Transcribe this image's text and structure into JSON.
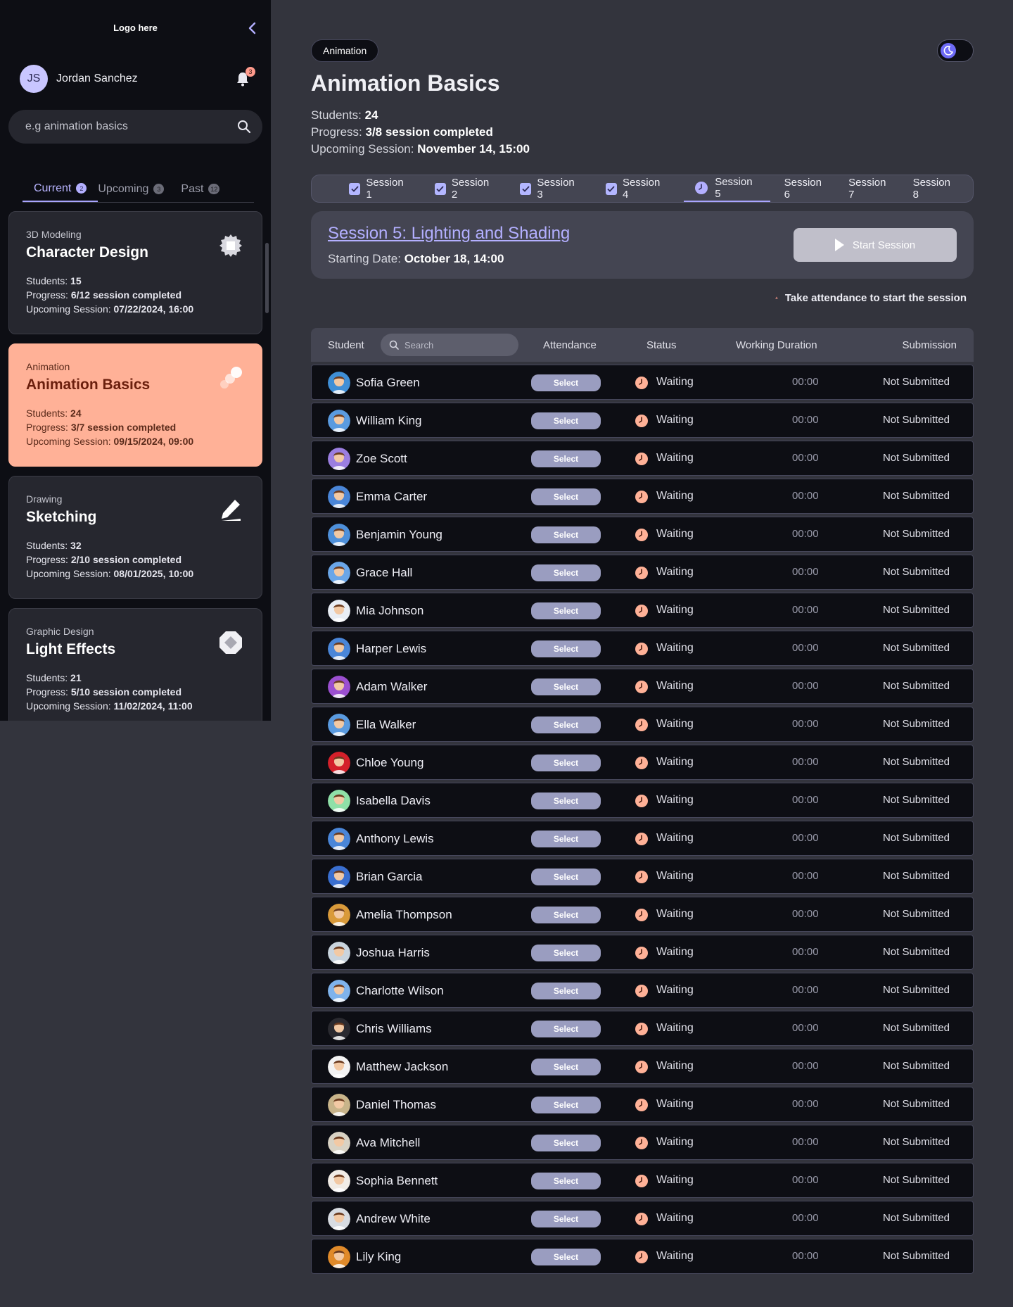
{
  "sidebar": {
    "logo": "Logo here",
    "user": {
      "initials": "JS",
      "name": "Jordan Sanchez",
      "notifications": "3"
    },
    "search": {
      "placeholder": "e.g animation basics",
      "value": ""
    },
    "tabs": [
      {
        "label": "Current",
        "count": "2"
      },
      {
        "label": "Upcoming",
        "count": "3"
      },
      {
        "label": "Past",
        "count": "12"
      }
    ],
    "courses": [
      {
        "category": "3D Modeling",
        "title": "Character Design",
        "students_label": "Students:",
        "students": "15",
        "progress_label": "Progress:",
        "progress": "6/12 session completed",
        "upcoming_label": "Upcoming Session:",
        "upcoming": "07/22/2024, 16:00",
        "icon": "cube-gear-icon"
      },
      {
        "category": "Animation",
        "title": "Animation Basics",
        "students_label": "Students:",
        "students": "24",
        "progress_label": "Progress:",
        "progress": "3/7 session completed",
        "upcoming_label": "Upcoming Session:",
        "upcoming": "09/15/2024, 09:00",
        "icon": "motion-dots-icon"
      },
      {
        "category": "Drawing",
        "title": "Sketching",
        "students_label": "Students:",
        "students": "32",
        "progress_label": "Progress:",
        "progress": "2/10 session completed",
        "upcoming_label": "Upcoming Session:",
        "upcoming": "08/01/2025, 10:00",
        "icon": "pencil-icon"
      },
      {
        "category": "Graphic Design",
        "title": "Light Effects",
        "students_label": "Students:",
        "students": "21",
        "progress_label": "Progress:",
        "progress": "5/10 session completed",
        "upcoming_label": "Upcoming Session:",
        "upcoming": "11/02/2024, 11:00",
        "icon": "diamond-icon"
      }
    ]
  },
  "main": {
    "chip": "Animation",
    "title": "Animation Basics",
    "stats": {
      "students_label": "Students:",
      "students": "24",
      "progress_label": "Progress:",
      "progress": "3/8 session completed",
      "upcoming_label": "Upcoming Session:",
      "upcoming": "November 14, 15:00"
    },
    "sessions": [
      "Session 1",
      "Session 2",
      "Session 3",
      "Session 4",
      "Session 5",
      "Session 6",
      "Session 7",
      "Session 8"
    ],
    "session_card": {
      "title": "Session 5: Lighting and Shading",
      "date_label": "Starting Date:",
      "date": "October 18, 14:00",
      "start_label": "Start Session"
    },
    "warning": "Take attendance to start the session",
    "table": {
      "headers": {
        "student": "Student",
        "attendance": "Attendance",
        "status": "Status",
        "duration": "Working Duration",
        "submission": "Submission"
      },
      "search_placeholder": "Search",
      "select_label": "Select",
      "rows": [
        {
          "name": "Sofia Green",
          "status": "Waiting",
          "duration": "00:00",
          "submission": "Not Submitted",
          "color": "#3f8fd6"
        },
        {
          "name": "William King",
          "status": "Waiting",
          "duration": "00:00",
          "submission": "Not Submitted",
          "color": "#5a9be0"
        },
        {
          "name": "Zoe Scott",
          "status": "Waiting",
          "duration": "00:00",
          "submission": "Not Submitted",
          "color": "#9b7ee0"
        },
        {
          "name": "Emma Carter",
          "status": "Waiting",
          "duration": "00:00",
          "submission": "Not Submitted",
          "color": "#4a86d8"
        },
        {
          "name": "Benjamin Young",
          "status": "Waiting",
          "duration": "00:00",
          "submission": "Not Submitted",
          "color": "#4e90da"
        },
        {
          "name": "Grace Hall",
          "status": "Waiting",
          "duration": "00:00",
          "submission": "Not Submitted",
          "color": "#6aa6e8"
        },
        {
          "name": "Mia Johnson",
          "status": "Waiting",
          "duration": "00:00",
          "submission": "Not Submitted",
          "color": "#e9eef5"
        },
        {
          "name": "Harper Lewis",
          "status": "Waiting",
          "duration": "00:00",
          "submission": "Not Submitted",
          "color": "#4a86d8"
        },
        {
          "name": "Adam Walker",
          "status": "Waiting",
          "duration": "00:00",
          "submission": "Not Submitted",
          "color": "#9b4fd0"
        },
        {
          "name": "Ella Walker",
          "status": "Waiting",
          "duration": "00:00",
          "submission": "Not Submitted",
          "color": "#5a9be0"
        },
        {
          "name": "Chloe Young",
          "status": "Waiting",
          "duration": "00:00",
          "submission": "Not Submitted",
          "color": "#d4202a"
        },
        {
          "name": "Isabella Davis",
          "status": "Waiting",
          "duration": "00:00",
          "submission": "Not Submitted",
          "color": "#8fe0a8"
        },
        {
          "name": "Anthony Lewis",
          "status": "Waiting",
          "duration": "00:00",
          "submission": "Not Submitted",
          "color": "#4a86d8"
        },
        {
          "name": "Brian Garcia",
          "status": "Waiting",
          "duration": "00:00",
          "submission": "Not Submitted",
          "color": "#3a6fd0"
        },
        {
          "name": "Amelia Thompson",
          "status": "Waiting",
          "duration": "00:00",
          "submission": "Not Submitted",
          "color": "#d99a3a"
        },
        {
          "name": "Joshua Harris",
          "status": "Waiting",
          "duration": "00:00",
          "submission": "Not Submitted",
          "color": "#c9d4de"
        },
        {
          "name": "Charlotte Wilson",
          "status": "Waiting",
          "duration": "00:00",
          "submission": "Not Submitted",
          "color": "#7fb3ec"
        },
        {
          "name": "Chris Williams",
          "status": "Waiting",
          "duration": "00:00",
          "submission": "Not Submitted",
          "color": "#2a2a30"
        },
        {
          "name": "Matthew Jackson",
          "status": "Waiting",
          "duration": "00:00",
          "submission": "Not Submitted",
          "color": "#f3f3f3"
        },
        {
          "name": "Daniel Thomas",
          "status": "Waiting",
          "duration": "00:00",
          "submission": "Not Submitted",
          "color": "#c8b48a"
        },
        {
          "name": "Ava Mitchell",
          "status": "Waiting",
          "duration": "00:00",
          "submission": "Not Submitted",
          "color": "#d8d2c4"
        },
        {
          "name": "Sophia Bennett",
          "status": "Waiting",
          "duration": "00:00",
          "submission": "Not Submitted",
          "color": "#f1ece6"
        },
        {
          "name": "Andrew White",
          "status": "Waiting",
          "duration": "00:00",
          "submission": "Not Submitted",
          "color": "#d8dce2"
        },
        {
          "name": "Lily King",
          "status": "Waiting",
          "duration": "00:00",
          "submission": "Not Submitted",
          "color": "#e08a2a"
        }
      ]
    }
  },
  "colors": {
    "accent": "#b3afff",
    "active_card": "#ffb197",
    "status_icon": "#ffb197",
    "select_button": "#9a9dc0"
  }
}
